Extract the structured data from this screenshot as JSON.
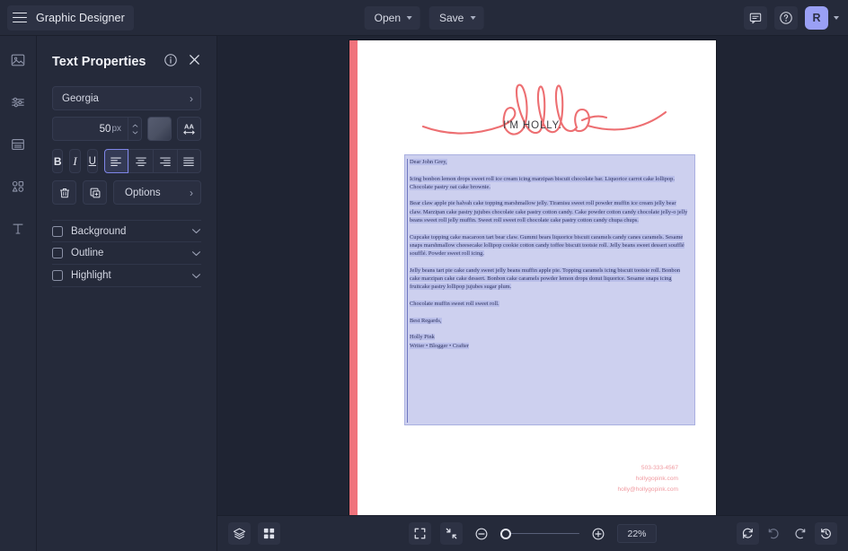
{
  "topbar": {
    "menu_icon": "hamburger-icon",
    "brand_title": "Graphic Designer",
    "open_label": "Open",
    "save_label": "Save",
    "comment_icon": "comment-icon",
    "help_icon": "help-circle-icon",
    "avatar_initial": "R",
    "avatar_color": "#9aa0f5"
  },
  "rail": {
    "items": [
      {
        "name": "image-icon",
        "label": "Images"
      },
      {
        "name": "adjustments-icon",
        "label": "Adjustments"
      },
      {
        "name": "layout-icon",
        "label": "Layout"
      },
      {
        "name": "shapes-icon",
        "label": "Shapes"
      },
      {
        "name": "text-icon",
        "label": "Text"
      }
    ]
  },
  "panel": {
    "title": "Text Properties",
    "info_icon": "info-circle-icon",
    "close_icon": "close-icon",
    "font_family": "Georgia",
    "font_size": "50",
    "font_size_unit": "px",
    "color_swatch": "#4b5164",
    "letter_spacing_icon": "letter-spacing-icon",
    "bold_label": "B",
    "italic_label": "I",
    "underline_label": "U",
    "align_options": [
      "align-left",
      "align-center",
      "align-right",
      "align-justify"
    ],
    "align_selected": "align-left",
    "delete_icon": "trash-icon",
    "duplicate_icon": "duplicate-icon",
    "options_label": "Options",
    "sections": [
      {
        "label": "Background",
        "checked": false
      },
      {
        "label": "Outline",
        "checked": false
      },
      {
        "label": "Highlight",
        "checked": false
      }
    ]
  },
  "canvas": {
    "accent_color": "#f0737c",
    "headline": "hello",
    "subhead": "I'M HOLLY.",
    "letter": {
      "greeting": "Dear John Grey,",
      "paragraph1": "Icing bonbon lemon drops sweet roll ice cream icing marzipan biscuit chocolate bar. Liquorice carrot cake lollipop. Chocolate pastry oat cake brownie.",
      "paragraph2": "Bear claw apple pie halvah cake topping marshmallow jelly. Tiramisu sweet roll powder muffin ice cream jelly bear claw. Marzipan cake pastry jujubes chocolate cake pastry cotton candy. Cake powder cotton candy chocolate jelly-o jelly beans sweet roll jelly muffin. Sweet roll sweet roll chocolate cake pastry cotton candy chupa chups.",
      "paragraph3": "Cupcake topping cake macaroon tart bear claw. Gummi bears liquorice biscuit caramels candy canes caramels. Sesame snaps marshmallow cheesecake lollipop cookie cotton candy toffee biscuit tootsie roll. Jelly beans sweet dessert soufflé soufflé. Powder sweet roll icing.",
      "paragraph4": "Jelly beans tart pie cake candy sweet jelly beans muffin apple pie. Topping caramels icing biscuit tootsie roll. Bonbon cake marzipan cake cake dessert. Bonbon cake caramels powder lemon drops donut liquorice. Sesame snaps icing fruitcake pastry lollipop jujubes sugar plum.",
      "paragraph5": "Chocolate muffin sweet roll sweet roll.",
      "signoff": "Best Regards,",
      "signature_name": "Holly Pink",
      "signature_role": "Writer • Blogger • Crafter"
    },
    "contact": {
      "phone": "503-333-4567",
      "website": "hollygopink.com",
      "email": "holly@hollygopink.com",
      "color": "#f09aa0"
    }
  },
  "bottombar": {
    "layers_icon": "layers-icon",
    "grid_icon": "grid-icon",
    "fit_screen_icon": "fit-to-screen-icon",
    "fit_selection_icon": "fit-selection-icon",
    "zoom_out_icon": "zoom-out-icon",
    "zoom_in_icon": "zoom-in-icon",
    "zoom_level": "22%",
    "zoom_slider_value": 0,
    "reset_icon": "reset-icon",
    "undo_icon": "undo-icon",
    "redo_icon": "redo-icon",
    "history_icon": "history-icon"
  }
}
